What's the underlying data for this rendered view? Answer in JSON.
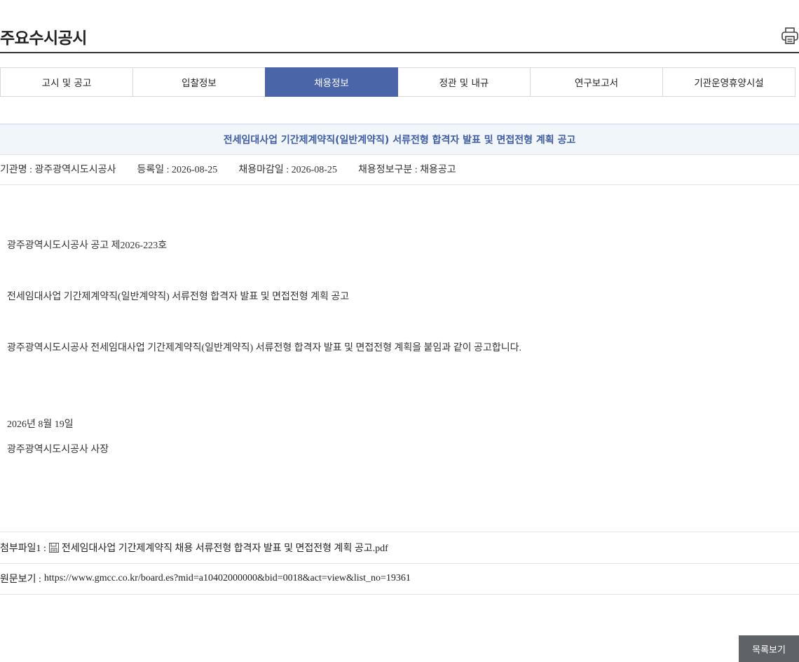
{
  "header": {
    "title": "주요수시공시",
    "print_icon": "printer-icon"
  },
  "tabs": [
    {
      "label": "고시 및 공고",
      "active": false
    },
    {
      "label": "입찰정보",
      "active": false
    },
    {
      "label": "채용정보",
      "active": true
    },
    {
      "label": "정관 및 내규",
      "active": false
    },
    {
      "label": "연구보고서",
      "active": false
    },
    {
      "label": "기관운영휴양시설",
      "active": false
    }
  ],
  "post": {
    "title": "전세임대사업 기간제계약직(일반계약직) 서류전형 합격자 발표 및 면접전형 계획 공고",
    "meta": {
      "org": "기관명 : 광주광역시도시공사",
      "registered": "등록일 : 2026-08-25",
      "deadline": "채용마감일 : 2026-08-25",
      "category": "채용정보구분 : 채용공고"
    },
    "body": {
      "notice_no": "광주광역시도시공사 공고 제2026-223호",
      "heading": "전세임대사업 기간제계약직(일반계약직) 서류전형 합격자 발표 및 면접전형 계획 공고",
      "statement": "광주광역시도시공사 전세임대사업 기간제계약직(일반계약직) 서류전형 합격자 발표 및 면접전형 계획을 붙임과 같이 공고합니다.",
      "date": "2026년 8월 19일",
      "signer": "광주광역시도시공사 사장"
    },
    "attachment": {
      "label": "첨부파일1 :",
      "filename": "전세임대사업 기간제계약직 채용 서류전형 합격자 발표 및 면접전형 계획 공고.pdf",
      "icon": "file-icon"
    },
    "source": {
      "label": "원문보기 :",
      "url": "https://www.gmcc.co.kr/board.es?mid=a10402000000&bid=0018&act=view&list_no=19361"
    }
  },
  "footer": {
    "list_button": "목록보기"
  },
  "colors": {
    "accent": "#4a66a8",
    "title_text": "#3f5da6",
    "title_bg": "#f1f6fb",
    "button_bg": "#5f6368"
  }
}
